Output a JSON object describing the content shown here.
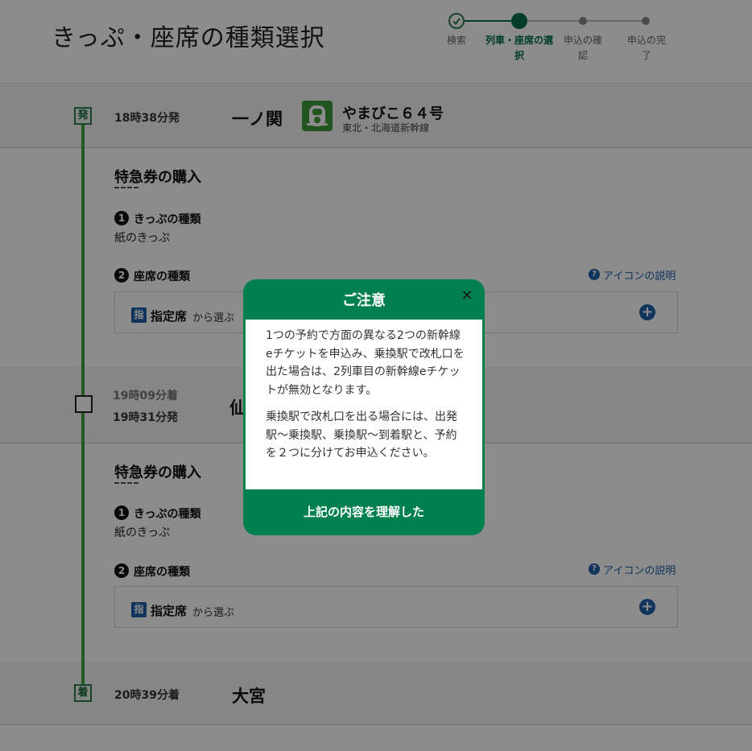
{
  "page_title": "きっぷ・座席の種類選択",
  "steps": [
    {
      "label": "検索"
    },
    {
      "label": "列車・座席の選択"
    },
    {
      "label": "申込の確認"
    },
    {
      "label": "申込の完了"
    }
  ],
  "departure": {
    "badge": "発",
    "time": "18時38分発",
    "station": "一ノ関",
    "train_name": "やまびこ６４号",
    "train_line": "東北・北海道新幹線"
  },
  "segment1": {
    "title": "特急券の購入",
    "ticket_type_num": "1",
    "ticket_type_label": "きっぷの種類",
    "ticket_type_value": "紙のきっぷ",
    "seat_type_num": "2",
    "seat_type_label": "座席の種類",
    "help_label": "アイコンの説明",
    "seat_tag": "指",
    "seat_name": "指定席",
    "seat_from": "から選ぶ"
  },
  "transfer": {
    "arrive_time": "19時09分着",
    "depart_time": "19時31分発",
    "station_partial": "仙"
  },
  "segment2": {
    "title": "特急券の購入",
    "ticket_type_num": "1",
    "ticket_type_label": "きっぷの種類",
    "ticket_type_value": "紙のきっぷ",
    "seat_type_num": "2",
    "seat_type_label": "座席の種類",
    "help_label": "アイコンの説明",
    "seat_tag": "指",
    "seat_name": "指定席",
    "seat_from": "から選ぶ"
  },
  "arrival": {
    "badge": "着",
    "time": "20時39分着",
    "station": "大宮"
  },
  "modal": {
    "title": "ご注意",
    "close": "×",
    "paragraph1": "1つの予約で方面の異なる2つの新幹線eチケットを申込み、乗換駅で改札口を出た場合は、2列車目の新幹線eチケットが無効となります。",
    "paragraph2": "乗換駅で改札口を出る場合には、出発駅〜乗換駅、乗換駅〜到着駅と、予約を２つに分けてお申込ください。",
    "confirm": "上記の内容を理解した"
  },
  "colors": {
    "accent_green": "#00804f",
    "timeline_green": "#42a142",
    "link_blue": "#1e5fa8"
  }
}
